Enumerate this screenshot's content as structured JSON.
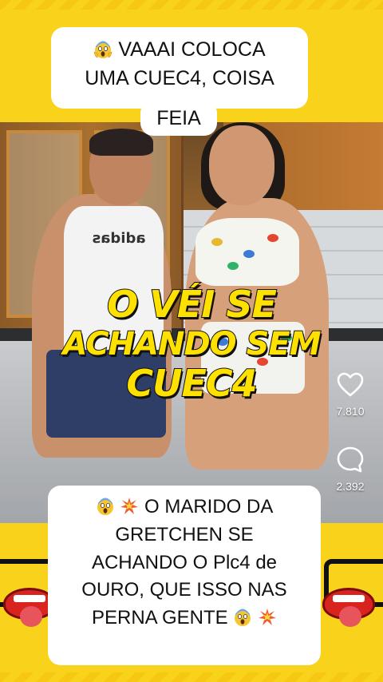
{
  "top_caption": {
    "line1": "VAAAI COLOCA",
    "line2": "UMA CUEC4, COISA",
    "line3": "FEIA",
    "emoji": "scream-emoji"
  },
  "video": {
    "shirt_logo": "adidas",
    "overlay_caption": {
      "line1": "O VÉI SE",
      "line2": "ACHANDO SEM",
      "line3": "CUEC4"
    }
  },
  "actions": {
    "like_count": "7.810",
    "comment_count": "2.392",
    "like_icon": "heart-icon",
    "comment_icon": "comment-bubble-icon"
  },
  "bottom_caption": {
    "line1": "O MARIDO DA",
    "line2": "GRETCHEN SE",
    "line3": "ACHANDO O Plc4 de",
    "line4": "OURO,  QUE ISSO NAS",
    "line5": "PERNA GENTE",
    "emojis": [
      "scream-emoji",
      "collision-emoji"
    ]
  },
  "colors": {
    "background": "#F9D21C",
    "overlay_text": "#FFE100",
    "caption_bg": "#FFFFFF"
  }
}
